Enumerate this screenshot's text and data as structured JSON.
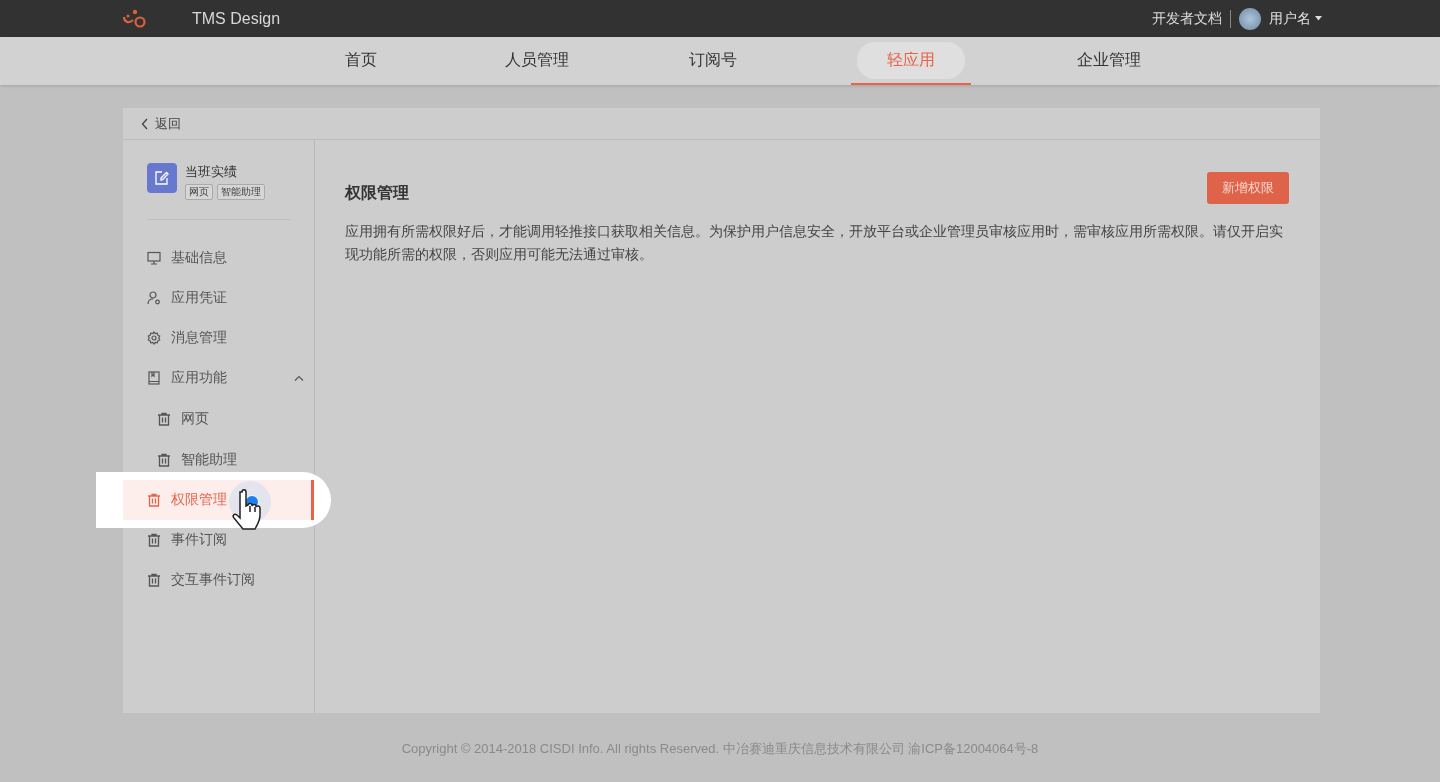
{
  "header": {
    "brand": "TMS Design",
    "docs_link": "开发者文档",
    "user_name": "用户名"
  },
  "nav": [
    {
      "label": "首页",
      "selected": false
    },
    {
      "label": "人员管理",
      "selected": false
    },
    {
      "label": "订阅号",
      "selected": false
    },
    {
      "label": "轻应用",
      "selected": true
    },
    {
      "label": "企业管理",
      "selected": false
    }
  ],
  "back": "返回",
  "app": {
    "name": "当班实绩",
    "tags": [
      "网页",
      "智能助理"
    ]
  },
  "sidebar": [
    {
      "label": "基础信息",
      "selected": false
    },
    {
      "label": "应用凭证",
      "selected": false
    },
    {
      "label": "消息管理",
      "selected": false
    },
    {
      "label": "应用功能",
      "expanded": true,
      "selected": false,
      "children": [
        {
          "label": "网页",
          "selected": false
        },
        {
          "label": "智能助理",
          "selected": false
        }
      ]
    },
    {
      "label": "权限管理",
      "selected": true
    },
    {
      "label": "事件订阅",
      "selected": false
    },
    {
      "label": "交互事件订阅",
      "selected": false
    }
  ],
  "main": {
    "title": "权限管理",
    "add_button": "新增权限",
    "description": "应用拥有所需权限好后，才能调用轻推接口获取相关信息。为保护用户信息安全，开放平台或企业管理员审核应用时，需审核应用所需权限。请仅开启实现功能所需的权限，否则应用可能无法通过审核。"
  },
  "footer": "Copyright © 2014-2018 CISDI Info. All rights Reserved. 中冶赛迪重庆信息技术有限公司 渝ICP备12004064号-8"
}
